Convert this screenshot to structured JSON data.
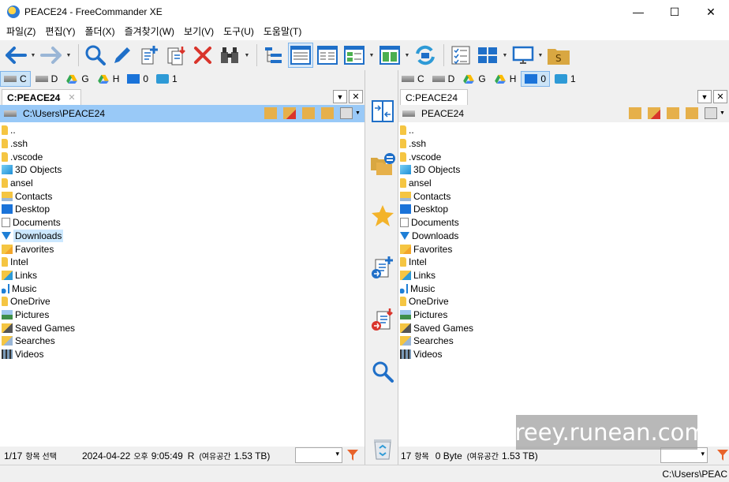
{
  "window": {
    "title": "PEACE24 - FreeCommander XE",
    "minimize": "—",
    "maximize": "☐",
    "close": "✕"
  },
  "menu": [
    "파일(Z)",
    "편집(Y)",
    "폴더(X)",
    "즐겨찾기(W)",
    "보기(V)",
    "도구(U)",
    "도움말(T)"
  ],
  "drives": [
    {
      "letter": "C",
      "icon": "hard-drive-icon"
    },
    {
      "letter": "D",
      "icon": "hard-drive-icon"
    },
    {
      "letter": "G",
      "icon": "google-drive-icon"
    },
    {
      "letter": "H",
      "icon": "google-drive-icon"
    },
    {
      "letter": "0",
      "icon": "desktop-icon"
    },
    {
      "letter": "1",
      "icon": "network-icon"
    }
  ],
  "left": {
    "tab": "C:PEACE24",
    "path": "C:\\Users\\PEACE24",
    "items": [
      {
        "name": "..",
        "icon": "folder-icon"
      },
      {
        "name": ".ssh",
        "icon": "folder-icon"
      },
      {
        "name": ".vscode",
        "icon": "folder-icon"
      },
      {
        "name": "3D Objects",
        "icon": "3d-objects-icon"
      },
      {
        "name": "ansel",
        "icon": "folder-icon"
      },
      {
        "name": "Contacts",
        "icon": "contacts-icon"
      },
      {
        "name": "Desktop",
        "icon": "desktop-icon"
      },
      {
        "name": "Documents",
        "icon": "documents-icon"
      },
      {
        "name": "Downloads",
        "icon": "download-icon"
      },
      {
        "name": "Favorites",
        "icon": "favorites-icon"
      },
      {
        "name": "Intel",
        "icon": "folder-icon"
      },
      {
        "name": "Links",
        "icon": "links-icon"
      },
      {
        "name": "Music",
        "icon": "music-icon"
      },
      {
        "name": "OneDrive",
        "icon": "folder-icon"
      },
      {
        "name": "Pictures",
        "icon": "pictures-icon"
      },
      {
        "name": "Saved Games",
        "icon": "saved-games-icon"
      },
      {
        "name": "Searches",
        "icon": "searches-icon"
      },
      {
        "name": "Videos",
        "icon": "videos-icon"
      }
    ],
    "selected_index": 8,
    "status": {
      "count": "1/17",
      "count_suffix": "항목 선택",
      "date": "2024-04-22",
      "ampm": "오후",
      "time": "9:05:49",
      "attr": "R",
      "free_label": "(여유공간",
      "free_value": "1.53 TB)"
    }
  },
  "right": {
    "tab": "C:PEACE24",
    "path": "PEACE24",
    "items": [
      {
        "name": "..",
        "icon": "folder-icon"
      },
      {
        "name": ".ssh",
        "icon": "folder-icon"
      },
      {
        "name": ".vscode",
        "icon": "folder-icon"
      },
      {
        "name": "3D Objects",
        "icon": "3d-objects-icon"
      },
      {
        "name": "ansel",
        "icon": "folder-icon"
      },
      {
        "name": "Contacts",
        "icon": "contacts-icon"
      },
      {
        "name": "Desktop",
        "icon": "desktop-icon"
      },
      {
        "name": "Documents",
        "icon": "documents-icon"
      },
      {
        "name": "Downloads",
        "icon": "download-icon"
      },
      {
        "name": "Favorites",
        "icon": "favorites-icon"
      },
      {
        "name": "Intel",
        "icon": "folder-icon"
      },
      {
        "name": "Links",
        "icon": "links-icon"
      },
      {
        "name": "Music",
        "icon": "music-icon"
      },
      {
        "name": "OneDrive",
        "icon": "folder-icon"
      },
      {
        "name": "Pictures",
        "icon": "pictures-icon"
      },
      {
        "name": "Saved Games",
        "icon": "saved-games-icon"
      },
      {
        "name": "Searches",
        "icon": "searches-icon"
      },
      {
        "name": "Videos",
        "icon": "videos-icon"
      }
    ],
    "status": {
      "count": "17",
      "count_suffix": "항목",
      "size": "0 Byte",
      "free_label": "(여유공간",
      "free_value": "1.53 TB)"
    }
  },
  "bottom_path": "C:\\Users\\PEAC",
  "watermark": "freey.runean.com",
  "colors": {
    "focus_path": "#99c9f7",
    "selection": "#cce8ff",
    "folder": "#f5c542",
    "accent": "#2e7bd6"
  }
}
